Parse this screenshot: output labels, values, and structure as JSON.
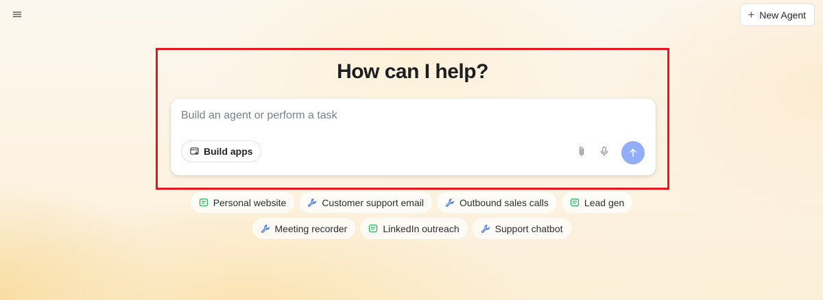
{
  "header": {
    "menu_icon": "hamburger-menu-icon",
    "new_agent": {
      "icon": "plus-icon",
      "label": "New Agent"
    }
  },
  "hero": {
    "title": "How can I help?",
    "input_placeholder": "Build an agent or perform a task",
    "input_value": "",
    "build_apps": {
      "icon": "app-window-plus-icon",
      "label": "Build apps"
    },
    "attach_icon": "paperclip-icon",
    "mic_icon": "microphone-icon",
    "send_icon": "arrow-up-icon",
    "send_color": "#93aef8"
  },
  "suggestions": {
    "row1": [
      {
        "label": "Personal website",
        "icon": "chat-bubble-icon"
      },
      {
        "label": "Customer support email",
        "icon": "wrench-icon"
      },
      {
        "label": "Outbound sales calls",
        "icon": "wrench-icon"
      },
      {
        "label": "Lead gen",
        "icon": "chat-bubble-icon"
      }
    ],
    "row2": [
      {
        "label": "Meeting recorder",
        "icon": "wrench-icon"
      },
      {
        "label": "LinkedIn outreach",
        "icon": "chat-bubble-icon"
      },
      {
        "label": "Support chatbot",
        "icon": "wrench-icon"
      }
    ]
  },
  "colors": {
    "highlight_border": "#e8141c",
    "wrench_blue": "#3b6ff5",
    "chat_green": "#22b35e"
  }
}
